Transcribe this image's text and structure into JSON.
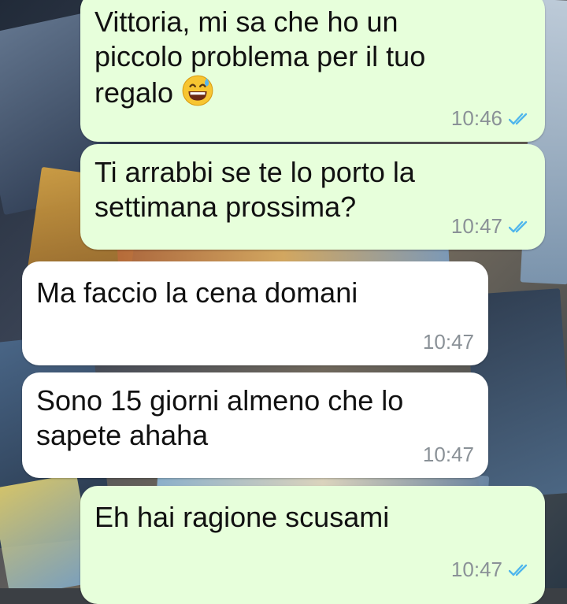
{
  "conversation": {
    "messages": [
      {
        "direction": "outgoing",
        "lines": [
          "Vittoria, mi sa che ho un",
          "piccolo problema per il tuo",
          "regalo"
        ],
        "emoji": "grinning-face-with-sweat-emoji",
        "time": "10:46",
        "status": "read-double-check"
      },
      {
        "direction": "outgoing",
        "lines": [
          "Ti arrabbi se te lo porto la",
          "settimana prossima?"
        ],
        "time": "10:47",
        "status": "read-double-check"
      },
      {
        "direction": "incoming",
        "lines": [
          "Ma faccio la cena domani"
        ],
        "time": "10:47"
      },
      {
        "direction": "incoming",
        "lines": [
          "Sono 15 giorni almeno che lo",
          "sapete ahaha"
        ],
        "time": "10:47"
      },
      {
        "direction": "outgoing",
        "lines": [
          "Eh hai ragione scusami"
        ],
        "time": "10:47",
        "status": "read-double-check"
      }
    ]
  },
  "colors": {
    "outgoing_bubble": "#e7ffdb",
    "incoming_bubble": "#ffffff",
    "read_tick": "#4fb6ec",
    "timestamp": "#8a9197"
  }
}
